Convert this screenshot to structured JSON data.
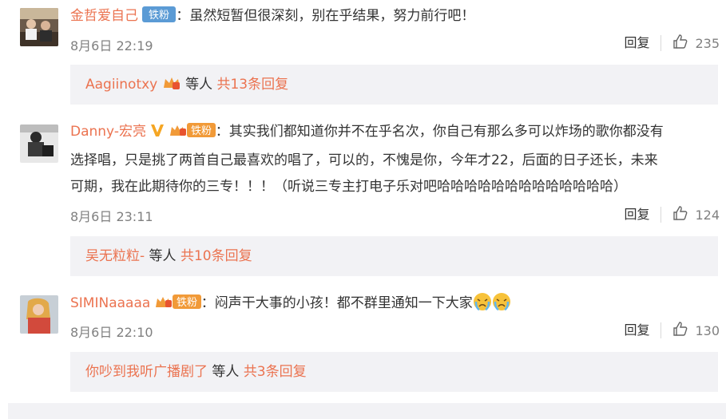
{
  "comments": [
    {
      "username": "金哲爱自己",
      "badge": "铁粉",
      "text": "：虽然短暂但很深刻，别在乎结果，努力前行吧！",
      "time": "8月6日 22:19",
      "reply_label": "回复",
      "likes": "235",
      "sub": {
        "user": "Aagiinotxy",
        "others": "等人",
        "more": "共13条回复"
      }
    },
    {
      "username": "Danny-宏亮",
      "badge": "铁粉",
      "text_lines": [
        "：其实我们都知道你并不在乎名次，你自己有那么多可以炸场的歌你都没有",
        "选择唱，只是挑了两首自己最喜欢的唱了，可以的，不愧是你，今年才22，后面的日子还长，未来",
        "可期，我在此期待你的三专！！！（听说三专主打电子乐对吧哈哈哈哈哈哈哈哈哈哈哈哈哈）"
      ],
      "time": "8月6日 23:11",
      "reply_label": "回复",
      "likes": "124",
      "sub": {
        "user": "吴无粒粒-",
        "others": "等人",
        "more": "共10条回复"
      }
    },
    {
      "username": "SIMINaaaaa",
      "badge": "铁粉",
      "text": "：闷声干大事的小孩！都不群里通知一下大家",
      "time": "8月6日 22:10",
      "reply_label": "回复",
      "likes": "130",
      "sub": {
        "user": "你吵到我听广播剧了",
        "others": "等人",
        "more": "共3条回复"
      }
    }
  ],
  "colors": {
    "username": "#eb7350",
    "badge_blue": "#5b9bd5",
    "badge_orange": "#f19a38",
    "meta": "#808080",
    "subbox_bg": "#f2f2f5"
  }
}
